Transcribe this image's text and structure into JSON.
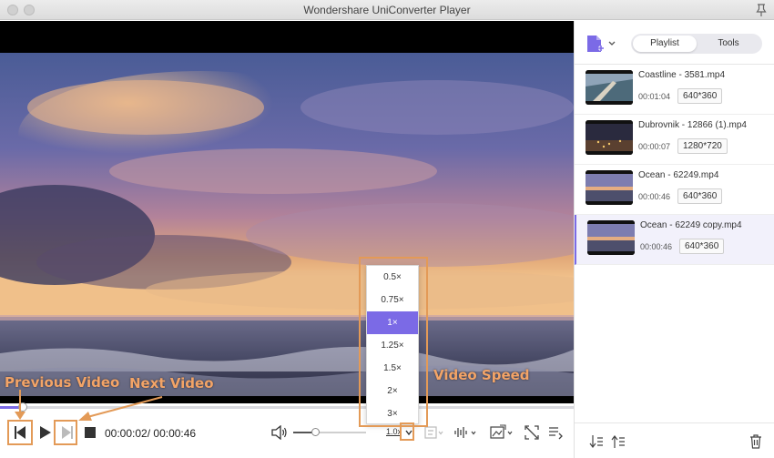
{
  "window": {
    "title": "Wondershare UniConverter Player"
  },
  "player": {
    "current_time": "00:00:02",
    "total_time": "00:00:46",
    "time_separator": "/ ",
    "progress": 0.04,
    "volume": 0.3,
    "speed_label": "1.0x",
    "speed_options": [
      "0.5×",
      "0.75×",
      "1×",
      "1.25×",
      "1.5×",
      "2×",
      "3×"
    ],
    "speed_selected_index": 2
  },
  "annotations": {
    "previous_video": "Previous Video",
    "next_video": "Next Video",
    "video_speed": "Video Speed",
    "color": "#e39a57"
  },
  "sidebar": {
    "tabs": [
      {
        "label": "Playlist",
        "active": true
      },
      {
        "label": "Tools",
        "active": false
      }
    ],
    "playlist": [
      {
        "name": "Coastline - 3581.mp4",
        "duration": "00:01:04",
        "resolution": "640*360",
        "active": false,
        "thumb": "coastline"
      },
      {
        "name": "Dubrovnik - 12866 (1).mp4",
        "duration": "00:00:07",
        "resolution": "1280*720",
        "active": false,
        "thumb": "city-night"
      },
      {
        "name": "Ocean - 62249.mp4",
        "duration": "00:00:46",
        "resolution": "640*360",
        "active": false,
        "thumb": "ocean"
      },
      {
        "name": "Ocean - 62249 copy.mp4",
        "duration": "00:00:46",
        "resolution": "640*360",
        "active": true,
        "thumb": "ocean"
      }
    ]
  },
  "colors": {
    "accent": "#7b6ae6",
    "annotation": "#e39a57"
  },
  "icons": [
    "pin-icon",
    "add-file-icon",
    "previous-icon",
    "play-icon",
    "next-icon",
    "stop-icon",
    "volume-icon",
    "subtitle-icon",
    "audio-track-icon",
    "screenshot-icon",
    "fullscreen-icon",
    "playlist-toggle-icon",
    "move-down-icon",
    "move-up-icon",
    "trash-icon"
  ]
}
